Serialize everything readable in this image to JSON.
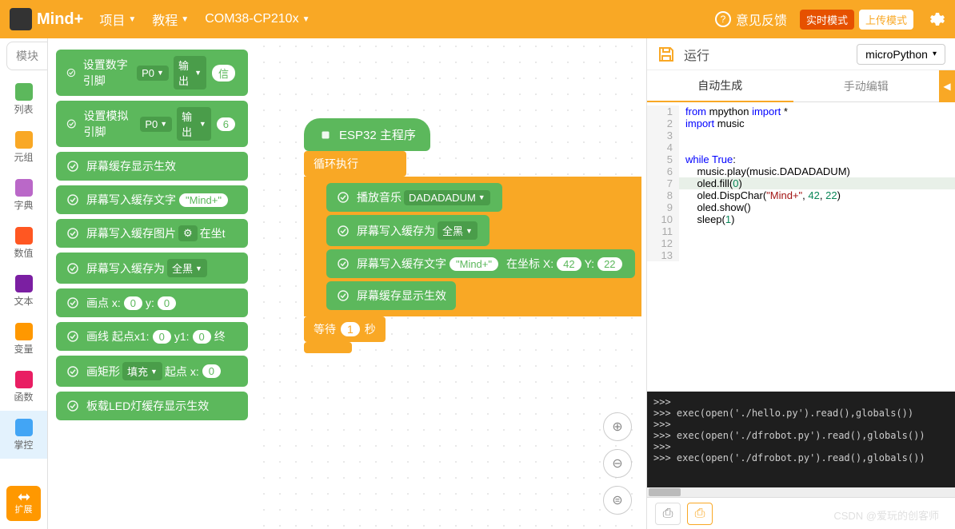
{
  "header": {
    "logo_text": "Mind",
    "logo_plus": "+",
    "menu_project": "项目",
    "menu_tutorial": "教程",
    "com_port": "COM38-CP210x",
    "feedback": "意见反馈",
    "mode_realtime": "实时模式",
    "mode_upload": "上传模式"
  },
  "sidebar": {
    "tab_module": "模块",
    "categories": [
      {
        "label": "列表",
        "color": "#5CB85C"
      },
      {
        "label": "元组",
        "color": "#F9A825"
      },
      {
        "label": "字典",
        "color": "#BA68C8"
      },
      {
        "label": "数值",
        "color": "#FF5722"
      },
      {
        "label": "文本",
        "color": "#7B1FA2"
      },
      {
        "label": "变量",
        "color": "#FF9800"
      },
      {
        "label": "函数",
        "color": "#E91E63"
      },
      {
        "label": "掌控",
        "color": "#42A5F5"
      }
    ],
    "extend": "扩展"
  },
  "palette": {
    "blocks": [
      {
        "label": "设置数字引脚",
        "dd1": "P0",
        "dd2": "输出",
        "arg": "信"
      },
      {
        "label": "设置模拟引脚",
        "dd1": "P0",
        "dd2": "输出",
        "arg": "6"
      },
      {
        "label": "屏幕缓存显示生效"
      },
      {
        "label": "屏幕写入缓存文字",
        "str": "\"Mind+\""
      },
      {
        "label": "屏幕写入缓存图片",
        "gear": true,
        "tail": "在坐t"
      },
      {
        "label": "屏幕写入缓存为",
        "dd1": "全黑"
      },
      {
        "label_parts": [
          "画点 x:",
          "0",
          "y:",
          "0"
        ]
      },
      {
        "label_parts": [
          "画线 起点x1:",
          "0",
          "y1:",
          "0",
          "终"
        ]
      },
      {
        "label_parts": [
          "画矩形",
          "填充",
          "起点 x:",
          "0"
        ]
      },
      {
        "label": "板载LED灯缓存显示生效"
      }
    ]
  },
  "workspace": {
    "hat": "ESP32 主程序",
    "loop_label": "循环执行",
    "inner": [
      {
        "label": "播放音乐",
        "dd": "DADADADUM"
      },
      {
        "label": "屏幕写入缓存为",
        "dd": "全黑"
      },
      {
        "label": "屏幕写入缓存文字",
        "str": "\"Mind+\"",
        "tail": "在坐标 X:",
        "x": "42",
        "y_label": "Y:",
        "y": "22"
      },
      {
        "label": "屏幕缓存显示生效"
      }
    ],
    "wait_label": "等待",
    "wait_val": "1",
    "wait_unit": "秒"
  },
  "right": {
    "run": "运行",
    "lang": "microPython",
    "tab_auto": "自动生成",
    "tab_manual": "手动编辑",
    "code_lines": [
      {
        "n": 1,
        "html": "<span class='kw'>from</span> mpython <span class='kw'>import</span> *"
      },
      {
        "n": 2,
        "html": "<span class='kw'>import</span> music"
      },
      {
        "n": 3,
        "html": ""
      },
      {
        "n": 4,
        "html": ""
      },
      {
        "n": 5,
        "html": "<span class='kw'>while</span> <span class='kw'>True</span>:"
      },
      {
        "n": 6,
        "html": "    music.play(music.DADADADUM)"
      },
      {
        "n": 7,
        "html": "    oled.fill(<span class='num'>0</span>)",
        "hl": true
      },
      {
        "n": 8,
        "html": "    oled.DispChar(<span class='str'>\"Mind+\"</span>, <span class='num'>42</span>, <span class='num'>22</span>)"
      },
      {
        "n": 9,
        "html": "    oled.show()"
      },
      {
        "n": 10,
        "html": "    sleep(<span class='num'>1</span>)"
      },
      {
        "n": 11,
        "html": ""
      },
      {
        "n": 12,
        "html": ""
      },
      {
        "n": 13,
        "html": ""
      }
    ],
    "terminal": ">>>\n>>> exec(open('./hello.py').read(),globals())\n>>>\n>>> exec(open('./dfrobot.py').read(),globals())\n>>>\n>>> exec(open('./dfrobot.py').read(),globals())\n"
  },
  "watermark": "CSDN @爱玩的创客师"
}
